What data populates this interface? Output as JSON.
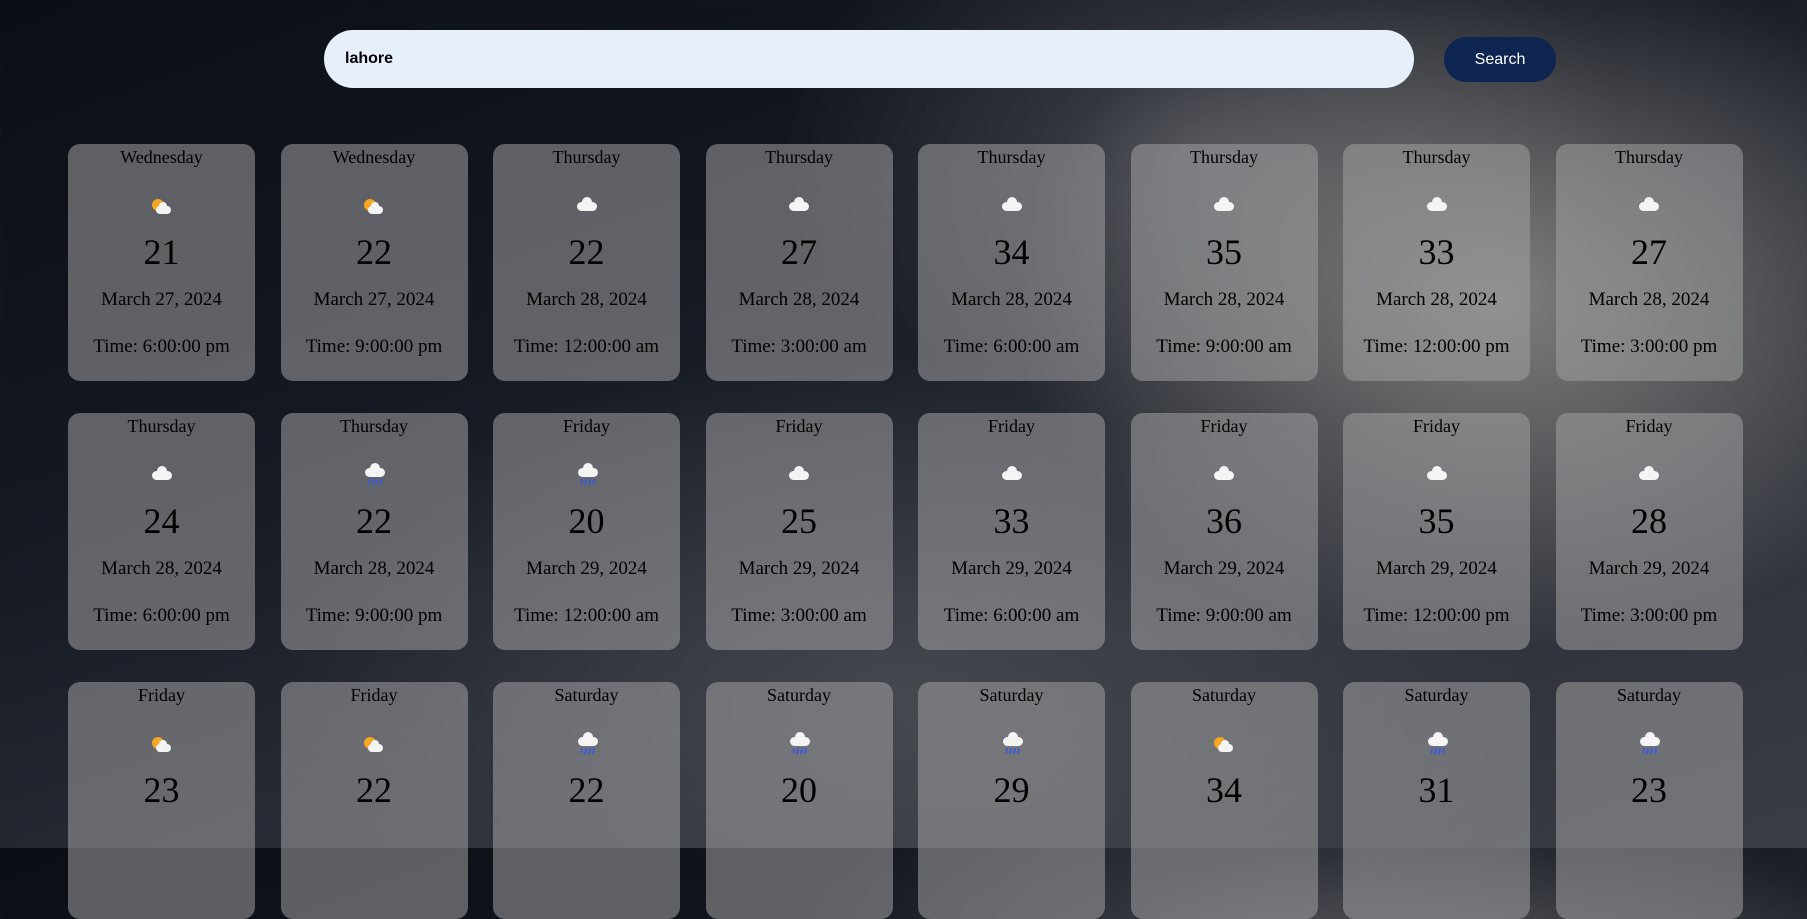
{
  "search": {
    "value": "lahore",
    "button_label": "Search"
  },
  "forecast": [
    {
      "day": "Wednesday",
      "icon": "partly-cloudy-icon",
      "temp": "21",
      "date": "March 27, 2024",
      "time": "Time: 6:00:00 pm"
    },
    {
      "day": "Wednesday",
      "icon": "partly-cloudy-icon",
      "temp": "22",
      "date": "March 27, 2024",
      "time": "Time: 9:00:00 pm"
    },
    {
      "day": "Thursday",
      "icon": "cloud-icon",
      "temp": "22",
      "date": "March 28, 2024",
      "time": "Time: 12:00:00 am"
    },
    {
      "day": "Thursday",
      "icon": "cloud-icon",
      "temp": "27",
      "date": "March 28, 2024",
      "time": "Time: 3:00:00 am"
    },
    {
      "day": "Thursday",
      "icon": "cloud-icon",
      "temp": "34",
      "date": "March 28, 2024",
      "time": "Time: 6:00:00 am"
    },
    {
      "day": "Thursday",
      "icon": "cloud-icon",
      "temp": "35",
      "date": "March 28, 2024",
      "time": "Time: 9:00:00 am"
    },
    {
      "day": "Thursday",
      "icon": "cloud-icon",
      "temp": "33",
      "date": "March 28, 2024",
      "time": "Time: 12:00:00 pm"
    },
    {
      "day": "Thursday",
      "icon": "cloud-icon",
      "temp": "27",
      "date": "March 28, 2024",
      "time": "Time: 3:00:00 pm"
    },
    {
      "day": "Thursday",
      "icon": "cloud-icon",
      "temp": "24",
      "date": "March 28, 2024",
      "time": "Time: 6:00:00 pm"
    },
    {
      "day": "Thursday",
      "icon": "rain-icon",
      "temp": "22",
      "date": "March 28, 2024",
      "time": "Time: 9:00:00 pm"
    },
    {
      "day": "Friday",
      "icon": "rain-icon",
      "temp": "20",
      "date": "March 29, 2024",
      "time": "Time: 12:00:00 am"
    },
    {
      "day": "Friday",
      "icon": "cloud-icon",
      "temp": "25",
      "date": "March 29, 2024",
      "time": "Time: 3:00:00 am"
    },
    {
      "day": "Friday",
      "icon": "cloud-icon",
      "temp": "33",
      "date": "March 29, 2024",
      "time": "Time: 6:00:00 am"
    },
    {
      "day": "Friday",
      "icon": "cloud-icon",
      "temp": "36",
      "date": "March 29, 2024",
      "time": "Time: 9:00:00 am"
    },
    {
      "day": "Friday",
      "icon": "cloud-icon",
      "temp": "35",
      "date": "March 29, 2024",
      "time": "Time: 12:00:00 pm"
    },
    {
      "day": "Friday",
      "icon": "cloud-icon",
      "temp": "28",
      "date": "March 29, 2024",
      "time": "Time: 3:00:00 pm"
    },
    {
      "day": "Friday",
      "icon": "partly-cloudy-icon",
      "temp": "23",
      "date": "",
      "time": ""
    },
    {
      "day": "Friday",
      "icon": "partly-cloudy-icon",
      "temp": "22",
      "date": "",
      "time": ""
    },
    {
      "day": "Saturday",
      "icon": "rain-icon",
      "temp": "22",
      "date": "",
      "time": ""
    },
    {
      "day": "Saturday",
      "icon": "rain-icon",
      "temp": "20",
      "date": "",
      "time": ""
    },
    {
      "day": "Saturday",
      "icon": "rain-icon",
      "temp": "29",
      "date": "",
      "time": ""
    },
    {
      "day": "Saturday",
      "icon": "partly-cloudy-icon",
      "temp": "34",
      "date": "",
      "time": ""
    },
    {
      "day": "Saturday",
      "icon": "rain-icon",
      "temp": "31",
      "date": "",
      "time": ""
    },
    {
      "day": "Saturday",
      "icon": "rain-icon",
      "temp": "23",
      "date": "",
      "time": ""
    }
  ]
}
